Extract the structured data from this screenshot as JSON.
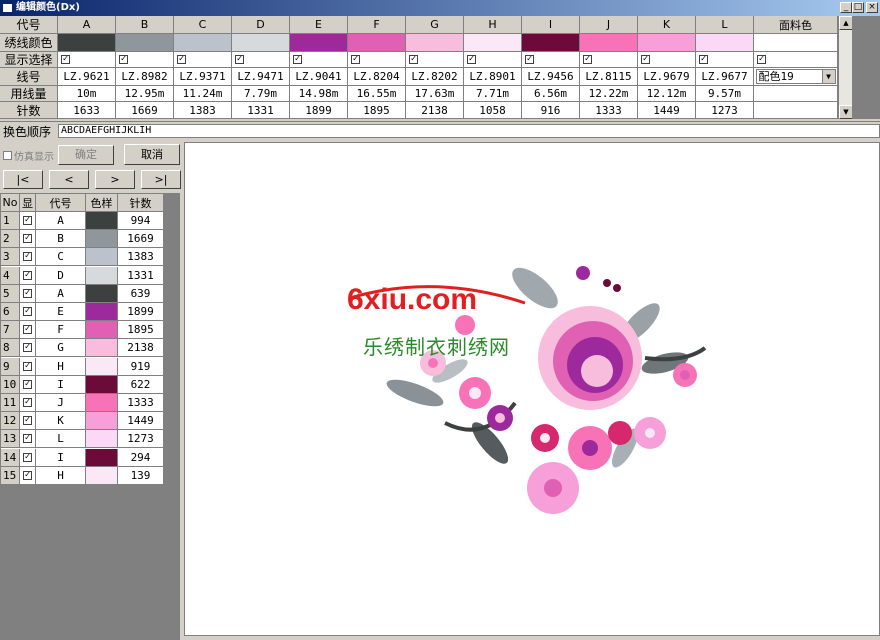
{
  "window": {
    "title": "编辑颜色(Dx)",
    "min": "_",
    "max": "□",
    "close": "×"
  },
  "grid": {
    "row_headers": [
      "代号",
      "绣线颜色",
      "显示选择",
      "线号",
      "用线量",
      "针数"
    ],
    "columns": [
      {
        "code": "A",
        "color": "#3c403e",
        "thread": "LZ.9621",
        "usage": "10m",
        "stitches": "1633"
      },
      {
        "code": "B",
        "color": "#8f969c",
        "thread": "LZ.8982",
        "usage": "12.95m",
        "stitches": "1669"
      },
      {
        "code": "C",
        "color": "#bcc2cb",
        "thread": "LZ.9371",
        "usage": "11.24m",
        "stitches": "1383"
      },
      {
        "code": "D",
        "color": "#d6dadd",
        "thread": "LZ.9471",
        "usage": "7.79m",
        "stitches": "1331"
      },
      {
        "code": "E",
        "color": "#9d2a9d",
        "thread": "LZ.9041",
        "usage": "14.98m",
        "stitches": "1899"
      },
      {
        "code": "F",
        "color": "#e060b4",
        "thread": "LZ.8204",
        "usage": "16.55m",
        "stitches": "1895"
      },
      {
        "code": "G",
        "color": "#f8bcdc",
        "thread": "LZ.8202",
        "usage": "17.63m",
        "stitches": "2138"
      },
      {
        "code": "H",
        "color": "#fbe8f6",
        "thread": "LZ.8901",
        "usage": "7.71m",
        "stitches": "1058"
      },
      {
        "code": "I",
        "color": "#6c0a3a",
        "thread": "LZ.9456",
        "usage": "6.56m",
        "stitches": "916"
      },
      {
        "code": "J",
        "color": "#f872b8",
        "thread": "LZ.8115",
        "usage": "12.22m",
        "stitches": "1333"
      },
      {
        "code": "K",
        "color": "#f79fd8",
        "thread": "LZ.9679",
        "usage": "12.12m",
        "stitches": "1449"
      },
      {
        "code": "L",
        "color": "#fbd8f6",
        "thread": "LZ.9677",
        "usage": "9.57m",
        "stitches": "1273"
      }
    ],
    "fabric_header": "面料色",
    "fabric_option": "配色19"
  },
  "sequence": {
    "label": "换色顺序",
    "value": "ABCDAEFGHIJKLIH"
  },
  "controls": {
    "simulate_label": "仿真显示",
    "confirm_label": "确定",
    "cancel_label": "取消",
    "nav_first": "|<",
    "nav_prev": "<",
    "nav_next": ">",
    "nav_last": ">|"
  },
  "list": {
    "headers": [
      "No",
      "显",
      "代号",
      "色样",
      "针数"
    ],
    "rows": [
      {
        "no": "1",
        "code": "A",
        "color": "#3c403e",
        "stitches": "994"
      },
      {
        "no": "2",
        "code": "B",
        "color": "#8f969c",
        "stitches": "1669"
      },
      {
        "no": "3",
        "code": "C",
        "color": "#bcc2cb",
        "stitches": "1383"
      },
      {
        "no": "4",
        "code": "D",
        "color": "#d6dadd",
        "stitches": "1331"
      },
      {
        "no": "5",
        "code": "A",
        "color": "#3c403e",
        "stitches": "639"
      },
      {
        "no": "6",
        "code": "E",
        "color": "#9d2a9d",
        "stitches": "1899"
      },
      {
        "no": "7",
        "code": "F",
        "color": "#e060b4",
        "stitches": "1895"
      },
      {
        "no": "8",
        "code": "G",
        "color": "#f8bcdc",
        "stitches": "2138"
      },
      {
        "no": "9",
        "code": "H",
        "color": "#fbe8f6",
        "stitches": "919"
      },
      {
        "no": "10",
        "code": "I",
        "color": "#6c0a3a",
        "stitches": "622"
      },
      {
        "no": "11",
        "code": "J",
        "color": "#f872b8",
        "stitches": "1333"
      },
      {
        "no": "12",
        "code": "K",
        "color": "#f79fd8",
        "stitches": "1449"
      },
      {
        "no": "13",
        "code": "L",
        "color": "#fbd8f6",
        "stitches": "1273"
      },
      {
        "no": "14",
        "code": "I",
        "color": "#6c0a3a",
        "stitches": "294"
      },
      {
        "no": "15",
        "code": "H",
        "color": "#fbe8f6",
        "stitches": "139"
      }
    ]
  },
  "watermark": {
    "site": "6xiu.com",
    "tagline": "乐绣制衣刺绣网"
  }
}
